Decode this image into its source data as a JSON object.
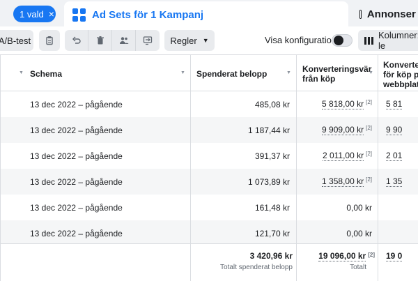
{
  "tabs": {
    "selected_pill": "1 vald",
    "active_tab": "Ad Sets för 1 Kampanj",
    "next_tab": "Annonser f"
  },
  "toolbar": {
    "ab_test": "A/B-test",
    "rules": "Regler",
    "show_config": "Visa konfiguration",
    "columns": "Kolumner: le"
  },
  "table": {
    "headers": {
      "schedule": "Schema",
      "spent": "Spenderat belopp",
      "conv_value_l1": "Konverteringsvär",
      "conv_value_l2": "från köp",
      "conv_web_l1": "Konverter",
      "conv_web_l2": "för köp på",
      "conv_web_l3": "webbplats"
    },
    "rows": [
      {
        "schedule": "13 dec 2022 – pågående",
        "spent": "485,08 kr",
        "conv_value": "5 818,00 kr",
        "conv_value_mark": "[2]",
        "conv_web": "5 81"
      },
      {
        "schedule": "13 dec 2022 – pågående",
        "spent": "1 187,44 kr",
        "conv_value": "9 909,00 kr",
        "conv_value_mark": "[2]",
        "conv_web": "9 90"
      },
      {
        "schedule": "13 dec 2022 – pågående",
        "spent": "391,37 kr",
        "conv_value": "2 011,00 kr",
        "conv_value_mark": "[2]",
        "conv_web": "2 01"
      },
      {
        "schedule": "13 dec 2022 – pågående",
        "spent": "1 073,89 kr",
        "conv_value": "1 358,00 kr",
        "conv_value_mark": "[2]",
        "conv_web": "1 35"
      },
      {
        "schedule": "13 dec 2022 – pågående",
        "spent": "161,48 kr",
        "conv_value": "0,00 kr",
        "conv_value_mark": "",
        "conv_web": ""
      },
      {
        "schedule": "13 dec 2022 – pågående",
        "spent": "121,70 kr",
        "conv_value": "0,00 kr",
        "conv_value_mark": "",
        "conv_web": ""
      }
    ],
    "totals": {
      "spent": "3 420,96 kr",
      "spent_label": "Totalt spenderat belopp",
      "conv_value": "19 096,00 kr",
      "conv_value_mark": "[2]",
      "conv_value_label": "Totalt",
      "conv_web": "19 0"
    }
  }
}
